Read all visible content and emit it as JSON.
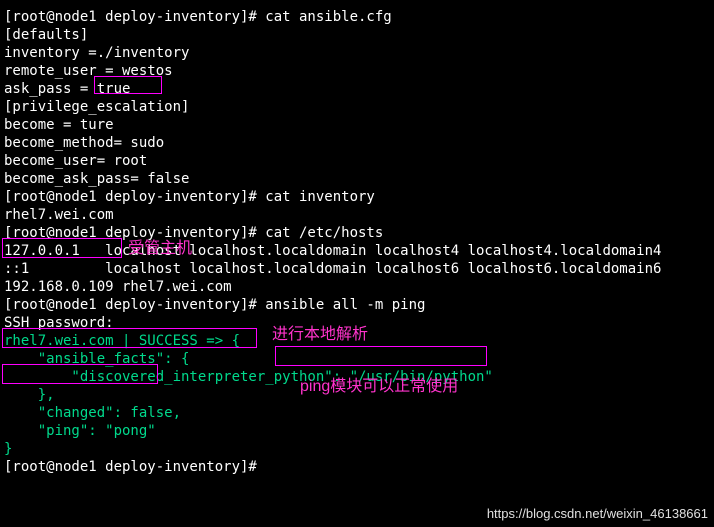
{
  "lines": {
    "l0": "[root@node1 deploy-inventory]# cat ansible.cfg",
    "l1": "[defaults]",
    "l2": "inventory =./inventory",
    "l3": "remote_user = westos",
    "l4": "ask_pass = true",
    "l5": "",
    "l6": "[privilege_escalation]",
    "l7": "become = ture",
    "l8": "become_method= sudo",
    "l9": "become_user= root",
    "l10": "become_ask_pass= false",
    "l11": "",
    "l12": "[root@node1 deploy-inventory]# cat inventory",
    "l13": "rhel7.wei.com",
    "l14": "",
    "l15": "[root@node1 deploy-inventory]# cat /etc/hosts",
    "l16": "127.0.0.1   localhost localhost.localdomain localhost4 localhost4.localdomain4",
    "l17": "::1         localhost localhost.localdomain localhost6 localhost6.localdomain6",
    "l18": "192.168.0.109 rhel7.wei.com",
    "l19": "[root@node1 deploy-inventory]# ansible all -m ping",
    "l20": "SSH password:"
  },
  "result": {
    "r0": "rhel7.wei.com | SUCCESS => {",
    "r1": "    \"ansible_facts\": {",
    "r2": "        \"discovered_interpreter_python\": \"/usr/bin/python\"",
    "r3": "    },",
    "r4": "    \"changed\": false,",
    "r5": "    \"ping\": \"pong\"",
    "r6": "}"
  },
  "prompt_end": "[root@node1 deploy-inventory]# ",
  "annotations": {
    "a1": "受管主机",
    "a2": "进行本地解析",
    "a3": "ping模块可以正常使用"
  },
  "watermark": "https://blog.csdn.net/weixin_46138661"
}
